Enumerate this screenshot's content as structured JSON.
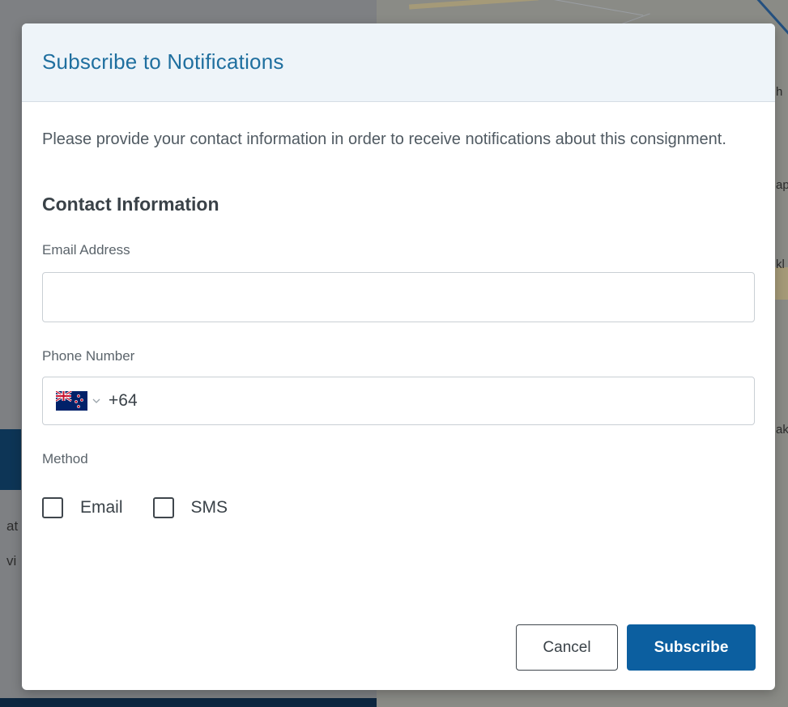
{
  "background": {
    "left_fragments": [
      "at",
      "vi"
    ],
    "right_fragments": [
      "h",
      "ap",
      "kl",
      "ak"
    ]
  },
  "modal": {
    "title": "Subscribe to Notifications",
    "intro": "Please provide your contact information in order to receive notifications about this consignment.",
    "section_title": "Contact Information",
    "email": {
      "label": "Email Address",
      "value": "",
      "placeholder": ""
    },
    "phone": {
      "label": "Phone Number",
      "country_flag": "new-zealand-flag-icon",
      "dial_code": "+64"
    },
    "method": {
      "label": "Method",
      "options": [
        {
          "label": "Email",
          "checked": false
        },
        {
          "label": "SMS",
          "checked": false
        }
      ]
    },
    "buttons": {
      "cancel": "Cancel",
      "subscribe": "Subscribe"
    }
  },
  "colors": {
    "title": "#1f6f9f",
    "header_bg": "#eef4f9",
    "primary_button": "#0c5fa0",
    "overlay": "#7f8184"
  }
}
